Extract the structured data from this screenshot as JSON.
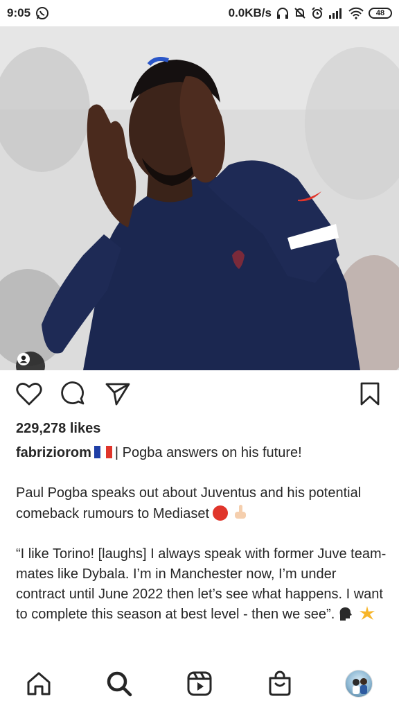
{
  "status_bar": {
    "time": "9:05",
    "net_speed": "0.0KB/s",
    "battery": "48",
    "icons": [
      "whatsapp-icon",
      "headphones-icon",
      "mute-bell-icon",
      "alarm-icon",
      "signal-icon",
      "wifi-icon",
      "battery-icon"
    ]
  },
  "post": {
    "image_icons": [
      "person-tag-icon"
    ],
    "actions": {
      "like_icon": "heart-icon",
      "comment_icon": "comment-icon",
      "share_icon": "send-icon",
      "save_icon": "bookmark-icon"
    },
    "likes": "229,278 likes",
    "username": "fabriziorom",
    "caption_title": "| Pogba answers on his future!",
    "caption_paragraph_1": "Paul Pogba speaks out about Juventus and his potential comeback rumours to Mediaset",
    "caption_paragraph_2": "“I like Torino! [laughs] I always speak with former Juve team-mates like Dybala. I’m in Manchester now, I’m under contract until June 2022 then let’s see what happens. I want to complete this season at best level - then we see”.",
    "emojis": [
      "france-flag",
      "red-circle",
      "pointing-down",
      "speaking-head",
      "sparkle"
    ]
  },
  "bottom_nav": {
    "items": [
      "home-icon",
      "search-icon",
      "reels-icon",
      "shop-icon",
      "profile-avatar"
    ],
    "active": "search-icon"
  },
  "colors": {
    "text": "#262626",
    "jersey_navy": "#1b2750",
    "accent_red": "#e0352b",
    "background": "#ffffff"
  }
}
